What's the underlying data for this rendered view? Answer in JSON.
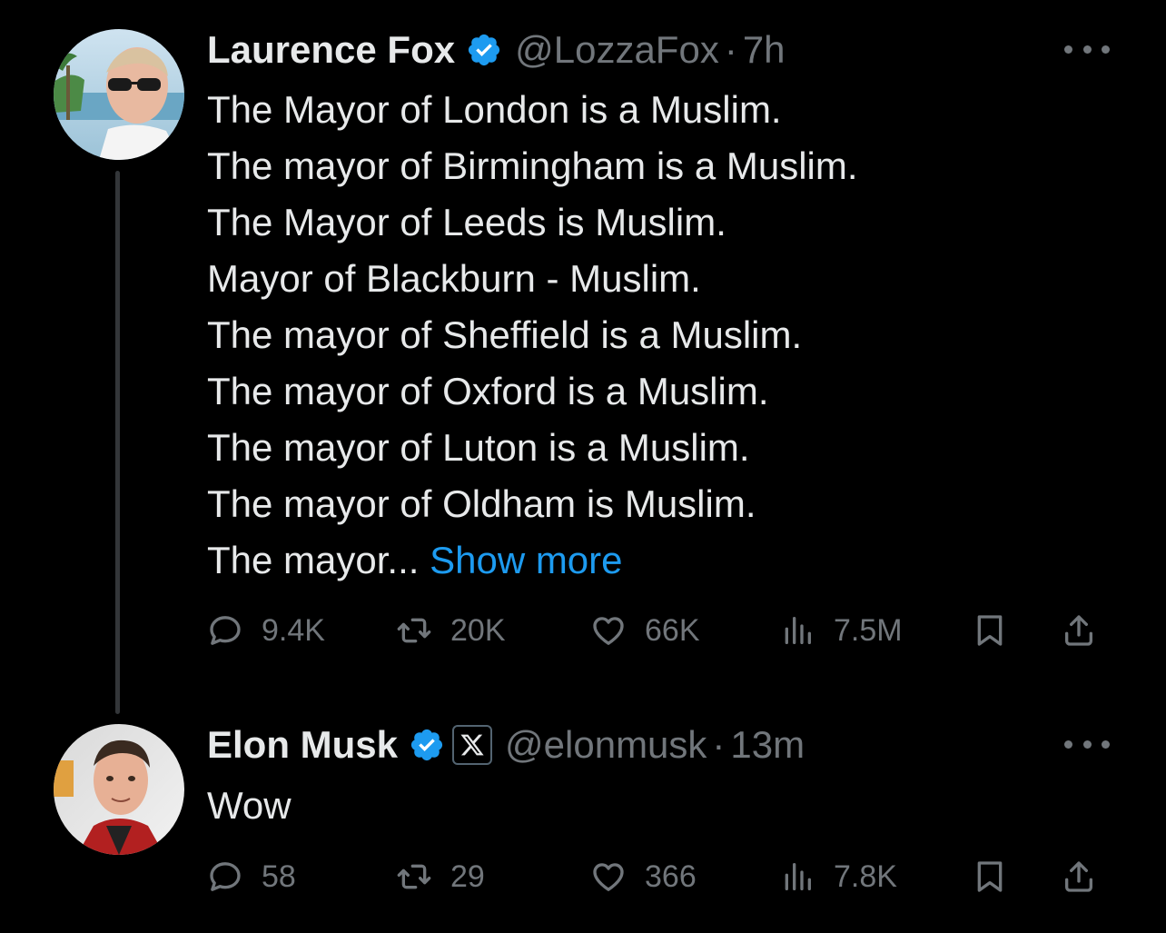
{
  "colors": {
    "background": "#000000",
    "primary_text": "#e7e9ea",
    "secondary_text": "#71767b",
    "link": "#1d9bf0",
    "verified": "#1d9bf0",
    "thread_line": "#333639"
  },
  "tweets": [
    {
      "display_name": "Laurence Fox",
      "verified_icon": "verified-badge-icon",
      "handle": "@LozzaFox",
      "separator": "·",
      "time": "7h",
      "lines": [
        "The Mayor of London is a Muslim.",
        "The mayor of Birmingham is a Muslim.",
        "The Mayor of Leeds is Muslim.",
        "Mayor of Blackburn - Muslim.",
        "The mayor of Sheffield is a Muslim.",
        "The mayor of Oxford is a Muslim.",
        "The mayor of Luton is a Muslim.",
        "The mayor of Oldham is Muslim."
      ],
      "truncated_line": "The mayor...",
      "show_more_label": "Show more",
      "actions": {
        "replies": "9.4K",
        "reposts": "20K",
        "likes": "66K",
        "views": "7.5M"
      }
    },
    {
      "display_name": "Elon Musk",
      "verified_icon": "verified-badge-icon",
      "affiliation_icon": "x-logo-icon",
      "handle": "@elonmusk",
      "separator": "·",
      "time": "13m",
      "text": "Wow",
      "actions": {
        "replies": "58",
        "reposts": "29",
        "likes": "366",
        "views": "7.8K"
      }
    }
  ]
}
